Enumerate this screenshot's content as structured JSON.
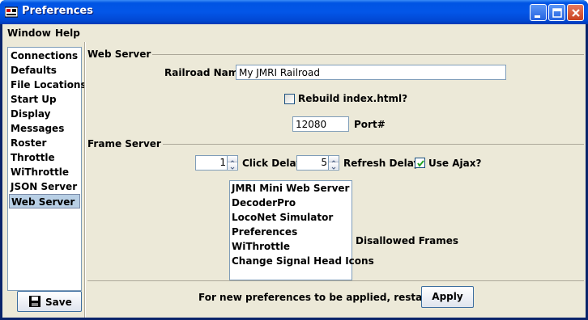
{
  "window": {
    "title": "Preferences"
  },
  "menu": {
    "items": [
      "Window",
      "Help"
    ]
  },
  "sidebar": {
    "items": [
      "Connections",
      "Defaults",
      "File Locations",
      "Start Up",
      "Display",
      "Messages",
      "Roster",
      "Throttle",
      "WiThrottle",
      "JSON Server",
      "Web Server"
    ],
    "selected": "Web Server",
    "save_label": "Save"
  },
  "web_server": {
    "section_title": "Web Server",
    "railroad_name_label": "Railroad Name",
    "railroad_name_value": "My JMRI Railroad",
    "rebuild_label": "Rebuild index.html?",
    "rebuild_checked": false,
    "port_value": "12080",
    "port_label": "Port#"
  },
  "frame_server": {
    "section_title": "Frame Server",
    "click_delay_value": "1",
    "click_delay_label": "Click Delay",
    "refresh_delay_value": "5",
    "refresh_delay_label": "Refresh Delay",
    "use_ajax_label": "Use Ajax?",
    "use_ajax_checked": true,
    "frames": [
      "JMRI Mini Web Server",
      "DecoderPro",
      "LocoNet Simulator",
      "Preferences",
      "WiThrottle",
      "Change Signal Head Icons"
    ],
    "disallowed_label": "Disallowed Frames"
  },
  "footer": {
    "restart_message": "For new preferences to be applied, restart JMRI",
    "apply_label": "Apply"
  },
  "colors": {
    "titlebar": "#0054e3",
    "selection": "#b8cfe5",
    "background": "#ece9d8"
  }
}
